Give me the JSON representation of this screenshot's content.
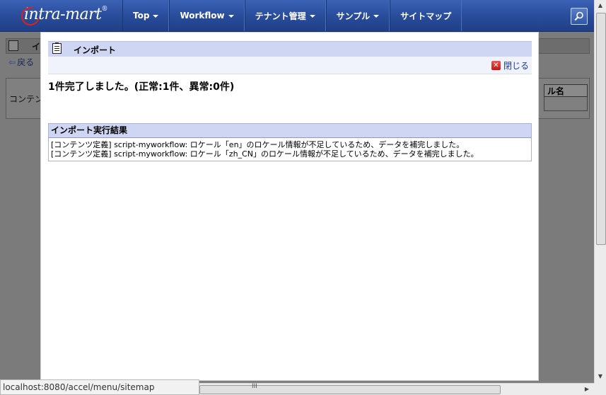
{
  "nav": {
    "logo_text": "intra-mart",
    "logo_mark": "®",
    "items": [
      {
        "label": "Top",
        "dropdown": true
      },
      {
        "label": "Workflow",
        "dropdown": true
      },
      {
        "label": "テナント管理",
        "dropdown": true
      },
      {
        "label": "サンプル",
        "dropdown": true
      },
      {
        "label": "サイトマップ",
        "dropdown": false
      }
    ],
    "search_icon": "search-icon"
  },
  "background": {
    "title_fragment": "イ",
    "back_label": "戻る",
    "panel_left_text": "コンテン",
    "panel_column_fragment": "ル名"
  },
  "modal": {
    "title": "インポート",
    "close_label": "閉じる",
    "result_message": "1件完了しました。(正常:1件、異常:0件)",
    "results_header": "インポート実行結果",
    "results": [
      "[コンテンツ定義] script-myworkflow: ロケール「en」のロケール情報が不足しているため、データを補完しました。",
      "[コンテンツ定義] script-myworkflow: ロケール「zh_CN」のロケール情報が不足しているため、データを補完しました。"
    ]
  },
  "status_bar": {
    "url": "localhost:8080/accel/menu/sitemap"
  },
  "colors": {
    "nav_bg": "#2a4d9c",
    "header_bg": "#cfd6f3",
    "link": "#1a3a9a"
  }
}
